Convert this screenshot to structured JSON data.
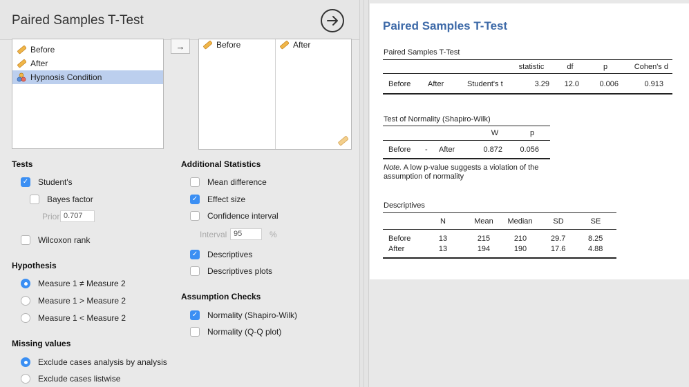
{
  "title": "Paired Samples T-Test",
  "variables": [
    {
      "label": "Before",
      "type": "scale",
      "selected": false
    },
    {
      "label": "After",
      "type": "scale",
      "selected": false
    },
    {
      "label": "Hypnosis Condition",
      "type": "nominal",
      "selected": true
    }
  ],
  "pair": {
    "first": "Before",
    "second": "After"
  },
  "tests": {
    "heading": "Tests",
    "students": {
      "label": "Student's",
      "checked": true
    },
    "bayes": {
      "label": "Bayes factor",
      "checked": false
    },
    "prior_label": "Prior",
    "prior_value": "0.707",
    "wilcoxon": {
      "label": "Wilcoxon rank",
      "checked": false
    }
  },
  "hypothesis": {
    "heading": "Hypothesis",
    "options": [
      {
        "label": "Measure 1 ≠ Measure 2",
        "selected": true
      },
      {
        "label": "Measure 1 > Measure 2",
        "selected": false
      },
      {
        "label": "Measure 1 < Measure 2",
        "selected": false
      }
    ]
  },
  "missing": {
    "heading": "Missing values",
    "options": [
      {
        "label": "Exclude cases analysis by analysis",
        "selected": true
      },
      {
        "label": "Exclude cases listwise",
        "selected": false
      }
    ]
  },
  "additional": {
    "heading": "Additional Statistics",
    "mean_diff": {
      "label": "Mean difference",
      "checked": false
    },
    "effect_size": {
      "label": "Effect size",
      "checked": true
    },
    "conf_int": {
      "label": "Confidence interval",
      "checked": false
    },
    "interval_label": "Interval",
    "interval_value": "95",
    "interval_unit": "%",
    "descriptives": {
      "label": "Descriptives",
      "checked": true
    },
    "desc_plots": {
      "label": "Descriptives plots",
      "checked": false
    }
  },
  "assumption": {
    "heading": "Assumption Checks",
    "shapiro": {
      "label": "Normality (Shapiro-Wilk)",
      "checked": true
    },
    "qq": {
      "label": "Normality (Q-Q plot)",
      "checked": false
    }
  },
  "results": {
    "title": "Paired Samples T-Test",
    "ttest": {
      "caption": "Paired Samples T-Test",
      "headers": [
        "statistic",
        "df",
        "p",
        "Cohen's d"
      ],
      "row": [
        "Before",
        "After",
        "Student's t",
        "3.29",
        "12.0",
        "0.006",
        "0.913"
      ]
    },
    "normality": {
      "caption": "Test of Normality (Shapiro-Wilk)",
      "headers": [
        "W",
        "p"
      ],
      "row": [
        "Before",
        "-",
        "After",
        "0.872",
        "0.056"
      ],
      "note_lead": "Note.",
      "note_text": " A low p-value suggests a violation of the assumption of normality"
    },
    "descriptives": {
      "caption": "Descriptives",
      "headers": [
        "N",
        "Mean",
        "Median",
        "SD",
        "SE"
      ],
      "rows": [
        [
          "Before",
          "13",
          "215",
          "210",
          "29.7",
          "8.25"
        ],
        [
          "After",
          "13",
          "194",
          "190",
          "17.6",
          "4.88"
        ]
      ]
    }
  },
  "colors": {
    "accent": "#3b8ff3",
    "result_title": "#3e6aa8",
    "selection": "#bccfee"
  },
  "icons": {
    "scale": "ruler-icon",
    "nominal": "nominal-variable-icon",
    "run": "arrow-circle-right-icon",
    "move": "arrow-right-icon"
  }
}
